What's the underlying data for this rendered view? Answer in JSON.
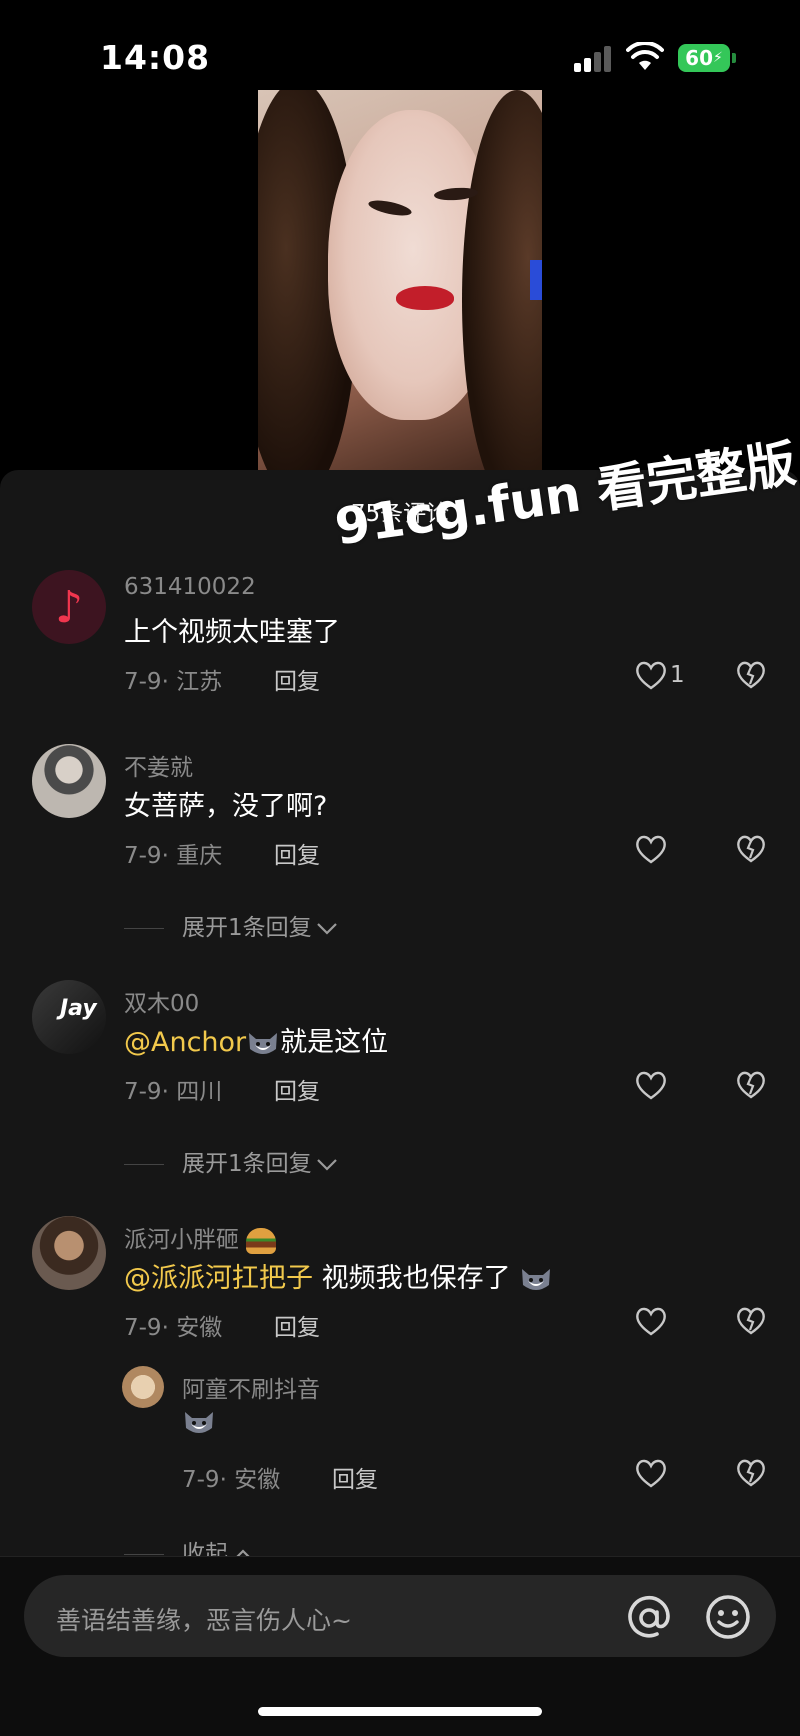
{
  "status": {
    "time": "14:08",
    "battery": "60"
  },
  "panel": {
    "title": "75条评论"
  },
  "watermark": "91cg.fun 看完整版",
  "comments": [
    {
      "username": "631410022",
      "text": "上个视频太哇塞了",
      "meta": "7-9· 江苏",
      "reply": "回复",
      "likes": "1"
    },
    {
      "username": "不姜就",
      "text": "女菩萨，没了啊?",
      "meta": "7-9· 重庆",
      "reply": "回复",
      "expand": "展开1条回复"
    },
    {
      "username": "双木00",
      "mention": "@Anchor",
      "text": "就是这位",
      "meta": "7-9· 四川",
      "reply": "回复",
      "expand": "展开1条回复"
    },
    {
      "username": "派河小胖砸",
      "mention": "@派派河扛把子",
      "text": " 视频我也保存了",
      "meta": "7-9· 安徽",
      "reply": "回复"
    }
  ],
  "sub_reply": {
    "username": "阿童不刷抖音",
    "meta": "7-9· 安徽",
    "reply": "回复",
    "collapse": "收起"
  },
  "input": {
    "placeholder": "善语结善缘，恶言伤人心~"
  },
  "icons": {
    "like": "heart-outline-icon",
    "dislike": "broken-heart-icon",
    "at": "at-icon",
    "emoji": "smile-icon",
    "chevron": "chevron-down-icon"
  }
}
